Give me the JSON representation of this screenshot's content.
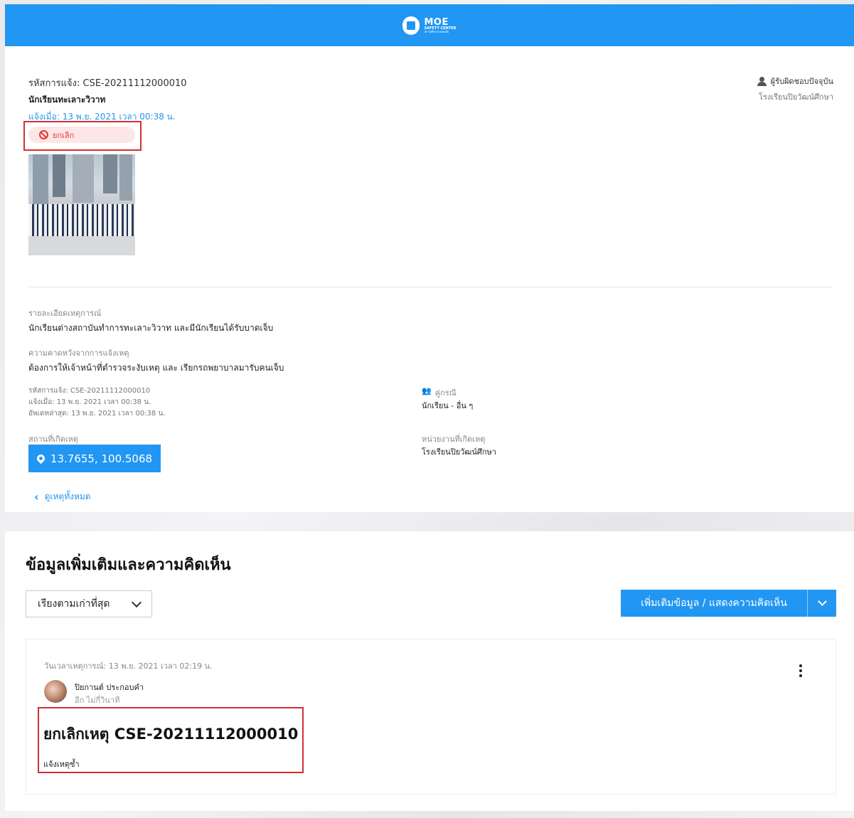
{
  "header": {
    "logo_main": "MOE",
    "logo_sub": "SAFETY CENTER",
    "logo_sub2": "สถานศึกษาปลอดภัย"
  },
  "case": {
    "code_label": "รหัสการแจ้ง: CSE-20211112000010",
    "title": "นักเรียนทะเลาะวิวาท",
    "reported_at": "แจ้งเมื่อ: 13 พ.ย. 2021 เวลา 00:38 น.",
    "status": "ยกเลิก",
    "status_icon": "ban-icon"
  },
  "responsible": {
    "label": "ผู้รับผิดชอบปัจจุบัน",
    "org": "โรงเรียนปิยวัฒน์ศึกษา"
  },
  "details": {
    "event_label": "รายละเอียดเหตุการณ์",
    "event_value": "นักเรียนต่างสถาบันทำการทะเลาะวิวาท และมีนักเรียนได้รับบาดเจ็บ",
    "expect_label": "ความคาดหวังจากการแจ้งเหตุ",
    "expect_value": "ต้องการให้เจ้าหน้าที่ตำรวจระงับเหตุ และ เรียกรถพยาบาลมารับคนเจ็บ",
    "meta_code": "รหัสการแจ้ง: CSE-20211112000010",
    "meta_reported": "แจ้งเมื่อ: 13 พ.ย. 2021 เวลา 00:38 น.",
    "meta_updated": "อัพเดทล่าสุด: 13 พ.ย. 2021 เวลา 00:38 น.",
    "party_label": "คู่กรณี",
    "party_value": "นักเรียน - อื่น ๆ",
    "location_label": "สถานที่เกิดเหตุ",
    "location_value": "13.7655, 100.5068",
    "unit_label": "หน่วยงานที่เกิดเหตุ",
    "unit_value": "โรงเรียนปิยวัฒน์ศึกษา"
  },
  "back_link": "ดูเหตุทั้งหมด",
  "comments_section": {
    "title": "ข้อมูลเพิ่มเติมและความคิดเห็น",
    "sort_value": "เรียงตามเก่าที่สุด",
    "add_button": "เพิ่มเติมข้อมูล / แสดงความคิดเห็น"
  },
  "comment": {
    "event_time": "วันเวลาเหตุการณ์: 13 พ.ย. 2021 เวลา 02:19 น.",
    "user": "ปิยกานต์ ประกอบคำ",
    "relative_time": "อีก ไม่กี่วินาที",
    "title": "ยกเลิกเหตุ CSE-20211112000010",
    "body": "แจ้งเหตุซ้ำ"
  },
  "colors": {
    "primary": "#2196f3",
    "danger": "#e53935"
  }
}
